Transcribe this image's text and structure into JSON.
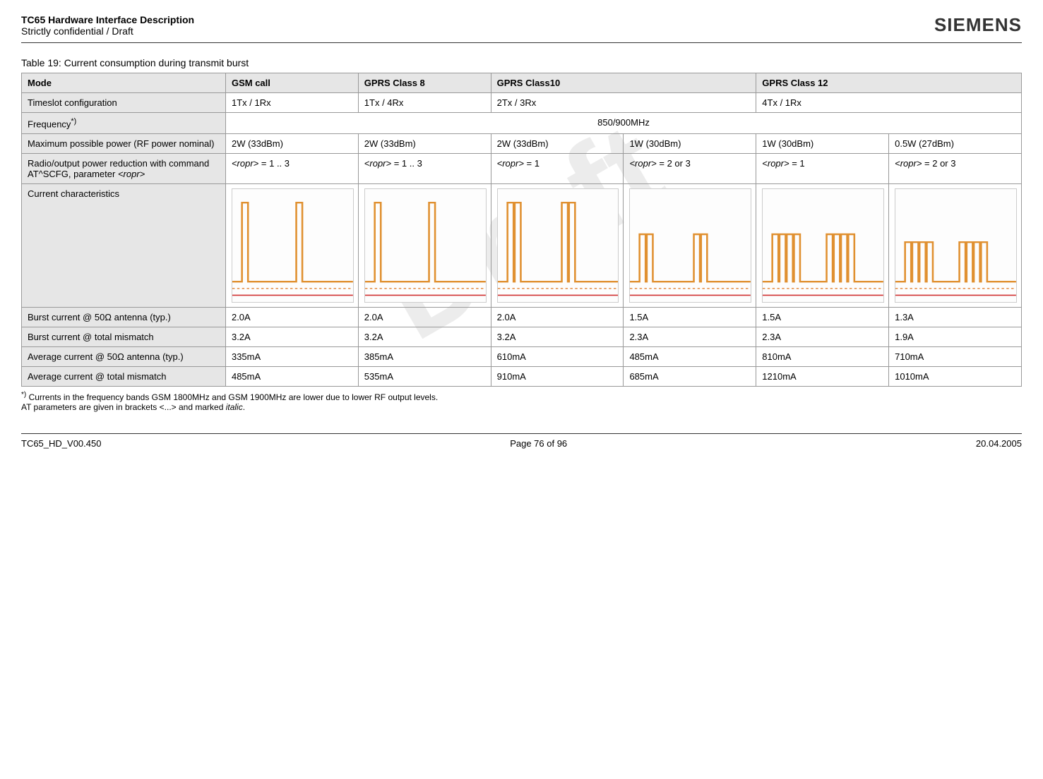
{
  "header": {
    "title": "TC65 Hardware Interface Description",
    "subtitle": "Strictly confidential / Draft",
    "logo": "SIEMENS"
  },
  "watermark": "Draft",
  "caption": "Table 19: Current consumption during transmit burst",
  "columns": {
    "mode": "Mode",
    "gsm": "GSM call",
    "c8": "GPRS Class 8",
    "c10": "GPRS Class10",
    "c12": "GPRS Class 12"
  },
  "rows": {
    "timeslot": {
      "label": "Timeslot configuration",
      "gsm": "1Tx / 1Rx",
      "c8": "1Tx / 4Rx",
      "c10": "2Tx / 3Rx",
      "c12": "4Tx / 1Rx"
    },
    "freq": {
      "label_html": "Frequency",
      "label_sup": "*)",
      "value": "850/900MHz"
    },
    "maxpower": {
      "label": "Maximum possible power (RF power nominal)",
      "v1": "2W (33dBm)",
      "v2": "2W (33dBm)",
      "v3": "2W (33dBm)",
      "v4": "1W (30dBm)",
      "v5": "1W (30dBm)",
      "v6": "0.5W (27dBm)"
    },
    "ropr": {
      "label_pre": "Radio/output power reduction with command AT^SCFG, parameter ",
      "label_param": "<ropr>",
      "param": "<ropr>",
      "v1": " = 1 .. 3",
      "v2": " = 1 .. 3",
      "v3": " = 1",
      "v4": " = 2 or 3",
      "v5": " = 1",
      "v6": " = 2 or 3"
    },
    "currchar": {
      "label": "Current characteristics"
    },
    "burst50": {
      "label": "Burst current @ 50Ω antenna (typ.)",
      "v1": "2.0A",
      "v2": "2.0A",
      "v3": "2.0A",
      "v4": "1.5A",
      "v5": "1.5A",
      "v6": "1.3A"
    },
    "burstmis": {
      "label": "Burst current @ total mismatch",
      "v1": "3.2A",
      "v2": "3.2A",
      "v3": "3.2A",
      "v4": "2.3A",
      "v5": "2.3A",
      "v6": "1.9A"
    },
    "avg50": {
      "label": "Average current @ 50Ω antenna (typ.)",
      "v1": "335mA",
      "v2": "385mA",
      "v3": "610mA",
      "v4": "485mA",
      "v5": "810mA",
      "v6": "710mA"
    },
    "avgmis": {
      "label": "Average current @ total mismatch",
      "v1": "485mA",
      "v2": "535mA",
      "v3": "910mA",
      "v4": "685mA",
      "v5": "1210mA",
      "v6": "1010mA"
    }
  },
  "footnote": {
    "sup": "*)",
    "line1": " Currents in the frequency bands GSM 1800MHz and GSM 1900MHz are lower due to lower RF output levels.",
    "line2_pre": "AT parameters are given in brackets <...> and marked ",
    "line2_it": "italic",
    "line2_post": "."
  },
  "footer": {
    "left": "TC65_HD_V00.450",
    "center": "Page 76 of 96",
    "right": "20.04.2005"
  },
  "chart_data": [
    {
      "type": "waveform",
      "description": "GSM 1Tx burst, single narrow high pulse per frame, peak ~2.0A, baseline noise low",
      "pulses": 1,
      "height_rel": 1.0
    },
    {
      "type": "waveform",
      "description": "GPRS Class 8 1Tx burst, single narrow high pulse per frame, peak ~2.0A",
      "pulses": 1,
      "height_rel": 1.0
    },
    {
      "type": "waveform",
      "description": "GPRS Class10 2Tx ropr=1, two adjacent high pulses per frame, peak ~2.0A",
      "pulses": 2,
      "height_rel": 1.0
    },
    {
      "type": "waveform",
      "description": "GPRS Class10 2Tx ropr=2/3, two adjacent medium pulses, peak ~1.5A",
      "pulses": 2,
      "height_rel": 0.6
    },
    {
      "type": "waveform",
      "description": "GPRS Class12 4Tx ropr=1, four adjacent medium pulses, peak ~1.5A",
      "pulses": 4,
      "height_rel": 0.6
    },
    {
      "type": "waveform",
      "description": "GPRS Class12 4Tx ropr=2/3, four adjacent lower pulses, peak ~1.3A",
      "pulses": 4,
      "height_rel": 0.5
    }
  ]
}
